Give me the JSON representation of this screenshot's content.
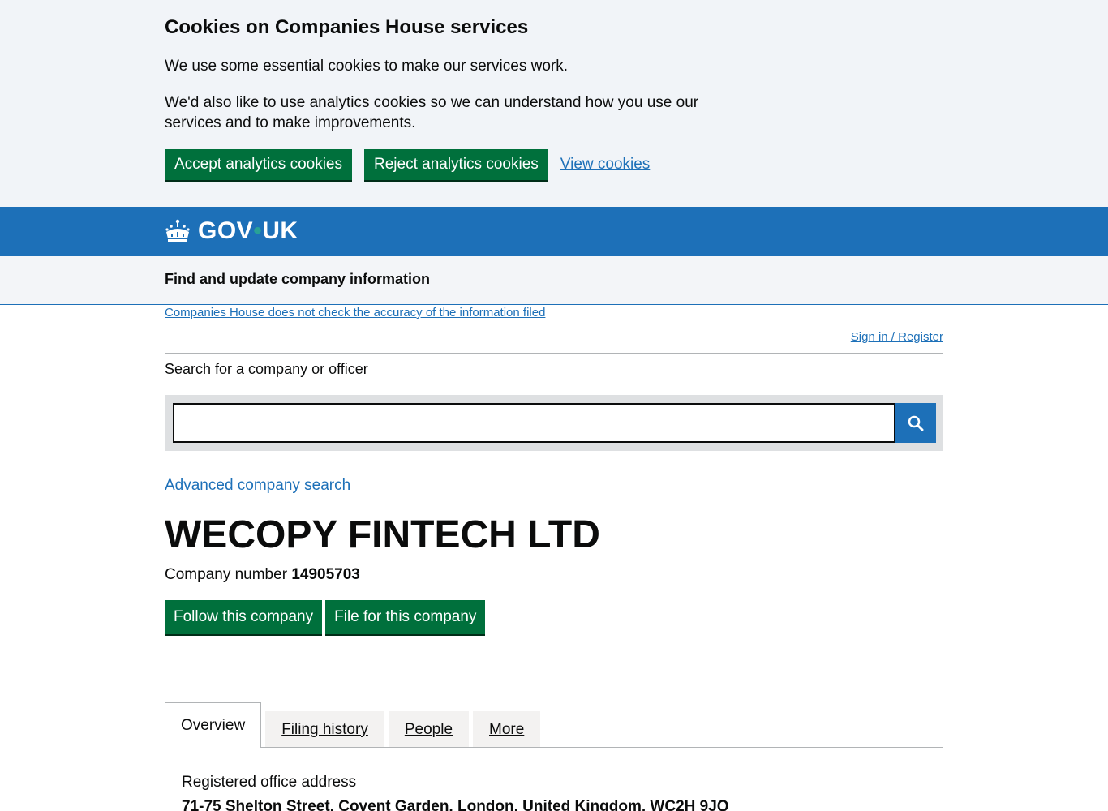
{
  "cookie_banner": {
    "title": "Cookies on Companies House services",
    "text1": "We use some essential cookies to make our services work.",
    "text2": "We'd also like to use analytics cookies so we can understand how you use our services and to make improvements.",
    "accept_label": "Accept analytics cookies",
    "reject_label": "Reject analytics cookies",
    "view_label": "View cookies"
  },
  "header": {
    "logo_gov": "GOV",
    "logo_dot": "•",
    "logo_uk": "UK",
    "crown_icon": "crown-icon"
  },
  "service": {
    "name": "Find and update company information"
  },
  "notices": {
    "accuracy_link": "Companies House does not check the accuracy of the information filed",
    "signin_link": "Sign in / Register"
  },
  "search": {
    "label": "Search for a company or officer",
    "value": "",
    "placeholder": "",
    "button_icon": "search-icon",
    "advanced_link": "Advanced company search"
  },
  "company": {
    "name": "WECOPY FINTECH LTD",
    "number_label": "Company number",
    "number": "14905703",
    "follow_label": "Follow this company",
    "file_label": "File for this company"
  },
  "tabs": {
    "items": [
      {
        "label": "Overview",
        "selected": true
      },
      {
        "label": "Filing history",
        "selected": false
      },
      {
        "label": "People",
        "selected": false
      },
      {
        "label": "More",
        "selected": false
      }
    ]
  },
  "overview": {
    "address_label": "Registered office address",
    "address_value": "71-75 Shelton Street, Covent Garden, London, United Kingdom, WC2H 9JQ"
  },
  "colors": {
    "green_button": "#00703c",
    "govuk_blue": "#1d70b8",
    "link_blue": "#1d70b8",
    "cookie_bg": "#f1f4f8"
  }
}
